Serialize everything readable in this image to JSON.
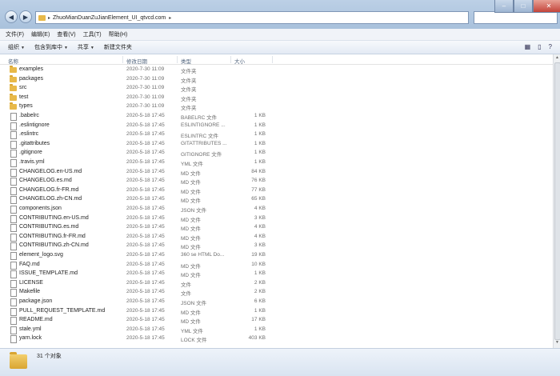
{
  "window": {
    "address": {
      "path": "ZhuoMianDuanZuJianElement_UI_qtvcd.com",
      "separator": "▸",
      "dropdown": "▸"
    },
    "controls": {
      "minimize": "–",
      "maximize": "□",
      "close": "✕"
    }
  },
  "menu": [
    "文件(F)",
    "编辑(E)",
    "查看(V)",
    "工具(T)",
    "帮助(H)"
  ],
  "toolbar": {
    "organize": "组织",
    "include_in_library": "包含到库中",
    "share": "共享",
    "new_folder": "新建文件夹",
    "arrow": "▼"
  },
  "columns": {
    "name": "名称",
    "date": "修改日期",
    "type": "类型",
    "size": "大小"
  },
  "files": [
    {
      "name": "examples",
      "date": "2020-7-30 11:09",
      "type": "文件夹",
      "size": "",
      "kind": "folder"
    },
    {
      "name": "packages",
      "date": "2020-7-30 11:09",
      "type": "文件夹",
      "size": "",
      "kind": "folder"
    },
    {
      "name": "src",
      "date": "2020-7-30 11:09",
      "type": "文件夹",
      "size": "",
      "kind": "folder"
    },
    {
      "name": "test",
      "date": "2020-7-30 11:09",
      "type": "文件夹",
      "size": "",
      "kind": "folder"
    },
    {
      "name": "types",
      "date": "2020-7-30 11:09",
      "type": "文件夹",
      "size": "",
      "kind": "folder"
    },
    {
      "name": ".babelrc",
      "date": "2020-5-18 17:45",
      "type": "BABELRC 文件",
      "size": "1 KB",
      "kind": "file"
    },
    {
      "name": ".eslintignore",
      "date": "2020-5-18 17:45",
      "type": "ESLINTIGNORE ...",
      "size": "1 KB",
      "kind": "file"
    },
    {
      "name": ".eslintrc",
      "date": "2020-5-18 17:45",
      "type": "ESLINTRC 文件",
      "size": "1 KB",
      "kind": "file"
    },
    {
      "name": ".gitattributes",
      "date": "2020-5-18 17:45",
      "type": "GITATTRIBUTES ...",
      "size": "1 KB",
      "kind": "file"
    },
    {
      "name": ".gitignore",
      "date": "2020-5-18 17:45",
      "type": "GITIGNORE 文件",
      "size": "1 KB",
      "kind": "file"
    },
    {
      "name": ".travis.yml",
      "date": "2020-5-18 17:45",
      "type": "YML 文件",
      "size": "1 KB",
      "kind": "file"
    },
    {
      "name": "CHANGELOG.en-US.md",
      "date": "2020-5-18 17:45",
      "type": "MD 文件",
      "size": "84 KB",
      "kind": "file"
    },
    {
      "name": "CHANGELOG.es.md",
      "date": "2020-5-18 17:45",
      "type": "MD 文件",
      "size": "76 KB",
      "kind": "file"
    },
    {
      "name": "CHANGELOG.fr-FR.md",
      "date": "2020-5-18 17:45",
      "type": "MD 文件",
      "size": "77 KB",
      "kind": "file"
    },
    {
      "name": "CHANGELOG.zh-CN.md",
      "date": "2020-5-18 17:45",
      "type": "MD 文件",
      "size": "65 KB",
      "kind": "file"
    },
    {
      "name": "components.json",
      "date": "2020-5-18 17:45",
      "type": "JSON 文件",
      "size": "4 KB",
      "kind": "file"
    },
    {
      "name": "CONTRIBUTING.en-US.md",
      "date": "2020-5-18 17:45",
      "type": "MD 文件",
      "size": "3 KB",
      "kind": "file"
    },
    {
      "name": "CONTRIBUTING.es.md",
      "date": "2020-5-18 17:45",
      "type": "MD 文件",
      "size": "4 KB",
      "kind": "file"
    },
    {
      "name": "CONTRIBUTING.fr-FR.md",
      "date": "2020-5-18 17:45",
      "type": "MD 文件",
      "size": "4 KB",
      "kind": "file"
    },
    {
      "name": "CONTRIBUTING.zh-CN.md",
      "date": "2020-5-18 17:45",
      "type": "MD 文件",
      "size": "3 KB",
      "kind": "file"
    },
    {
      "name": "element_logo.svg",
      "date": "2020-5-18 17:45",
      "type": "360 se HTML Do...",
      "size": "19 KB",
      "kind": "file"
    },
    {
      "name": "FAQ.md",
      "date": "2020-5-18 17:45",
      "type": "MD 文件",
      "size": "10 KB",
      "kind": "file"
    },
    {
      "name": "ISSUE_TEMPLATE.md",
      "date": "2020-5-18 17:45",
      "type": "MD 文件",
      "size": "1 KB",
      "kind": "file"
    },
    {
      "name": "LICENSE",
      "date": "2020-5-18 17:45",
      "type": "文件",
      "size": "2 KB",
      "kind": "file"
    },
    {
      "name": "Makefile",
      "date": "2020-5-18 17:45",
      "type": "文件",
      "size": "2 KB",
      "kind": "file"
    },
    {
      "name": "package.json",
      "date": "2020-5-18 17:45",
      "type": "JSON 文件",
      "size": "6 KB",
      "kind": "file"
    },
    {
      "name": "PULL_REQUEST_TEMPLATE.md",
      "date": "2020-5-18 17:45",
      "type": "MD 文件",
      "size": "1 KB",
      "kind": "file"
    },
    {
      "name": "README.md",
      "date": "2020-5-18 17:45",
      "type": "MD 文件",
      "size": "17 KB",
      "kind": "file"
    },
    {
      "name": "stale.yml",
      "date": "2020-5-18 17:45",
      "type": "YML 文件",
      "size": "1 KB",
      "kind": "file"
    },
    {
      "name": "yarn.lock",
      "date": "2020-5-18 17:45",
      "type": "LOCK 文件",
      "size": "403 KB",
      "kind": "file"
    }
  ],
  "status": {
    "count_text": "31 个对象"
  }
}
